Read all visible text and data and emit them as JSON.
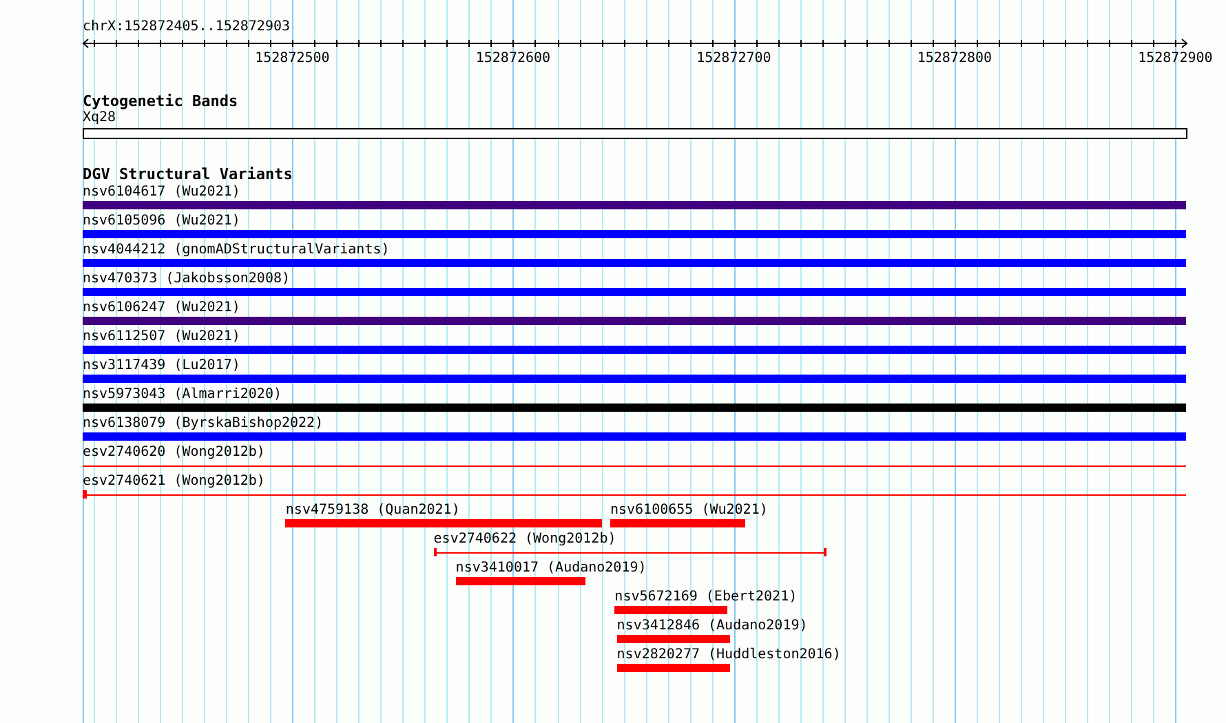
{
  "ruler": {
    "location": "chrX:152872405..152872903",
    "ticks": [
      "152872500",
      "152872600",
      "152872700",
      "152872800",
      "152872900"
    ]
  },
  "cytogenetic_bands": {
    "title": "Cytogenetic Bands",
    "band": "Xq28"
  },
  "dgv_structural_variants": {
    "title": "DGV Structural Variants",
    "rows": [
      {
        "features": [
          {
            "label": "nsv6104617 (Wu2021)",
            "kind": "bar",
            "color": "#400080"
          }
        ]
      },
      {
        "features": [
          {
            "label": "nsv6105096 (Wu2021)",
            "kind": "bar",
            "color": "#0000ff"
          }
        ]
      },
      {
        "features": [
          {
            "label": "nsv4044212 (gnomADStructuralVariants)",
            "kind": "bar",
            "color": "#0000ff"
          }
        ]
      },
      {
        "features": [
          {
            "label": "nsv470373 (Jakobsson2008)",
            "kind": "bar",
            "color": "#0000ff"
          }
        ]
      },
      {
        "features": [
          {
            "label": "nsv6106247 (Wu2021)",
            "kind": "bar",
            "color": "#400080"
          }
        ]
      },
      {
        "features": [
          {
            "label": "nsv6112507 (Wu2021)",
            "kind": "bar",
            "color": "#0000ff"
          }
        ]
      },
      {
        "features": [
          {
            "label": "nsv3117439 (Lu2017)",
            "kind": "bar",
            "color": "#0000ff"
          }
        ]
      },
      {
        "features": [
          {
            "label": "nsv5973043 (Almarri2020)",
            "kind": "bar",
            "color": "#000000"
          }
        ]
      },
      {
        "features": [
          {
            "label": "nsv6138079 (ByrskaBishop2022)",
            "kind": "bar",
            "color": "#0000ff"
          }
        ]
      },
      {
        "features": [
          {
            "label": "esv2740620 (Wong2012b)",
            "kind": "line",
            "color": "#ff0000"
          }
        ]
      },
      {
        "features": [
          {
            "label": "esv2740621 (Wong2012b)",
            "kind": "line-start-block",
            "color": "#ff0000"
          }
        ]
      },
      {
        "features": [
          {
            "label": "nsv4759138 (Quan2021)",
            "kind": "bar",
            "color": "#ff0000"
          },
          {
            "label": "nsv6100655 (Wu2021)",
            "kind": "bar",
            "color": "#ff0000"
          }
        ]
      },
      {
        "features": [
          {
            "label": "esv2740622 (Wong2012b)",
            "kind": "capped-line",
            "color": "#ff0000"
          }
        ]
      },
      {
        "features": [
          {
            "label": "nsv3410017 (Audano2019)",
            "kind": "bar",
            "color": "#ff0000"
          }
        ]
      },
      {
        "features": [
          {
            "label": "nsv5672169 (Ebert2021)",
            "kind": "bar",
            "color": "#ff0000"
          }
        ]
      },
      {
        "features": [
          {
            "label": "nsv3412846 (Audano2019)",
            "kind": "bar",
            "color": "#ff0000"
          }
        ]
      },
      {
        "features": [
          {
            "label": "nsv2820277 (Huddleston2016)",
            "kind": "bar",
            "color": "#ff0000"
          }
        ]
      }
    ]
  }
}
